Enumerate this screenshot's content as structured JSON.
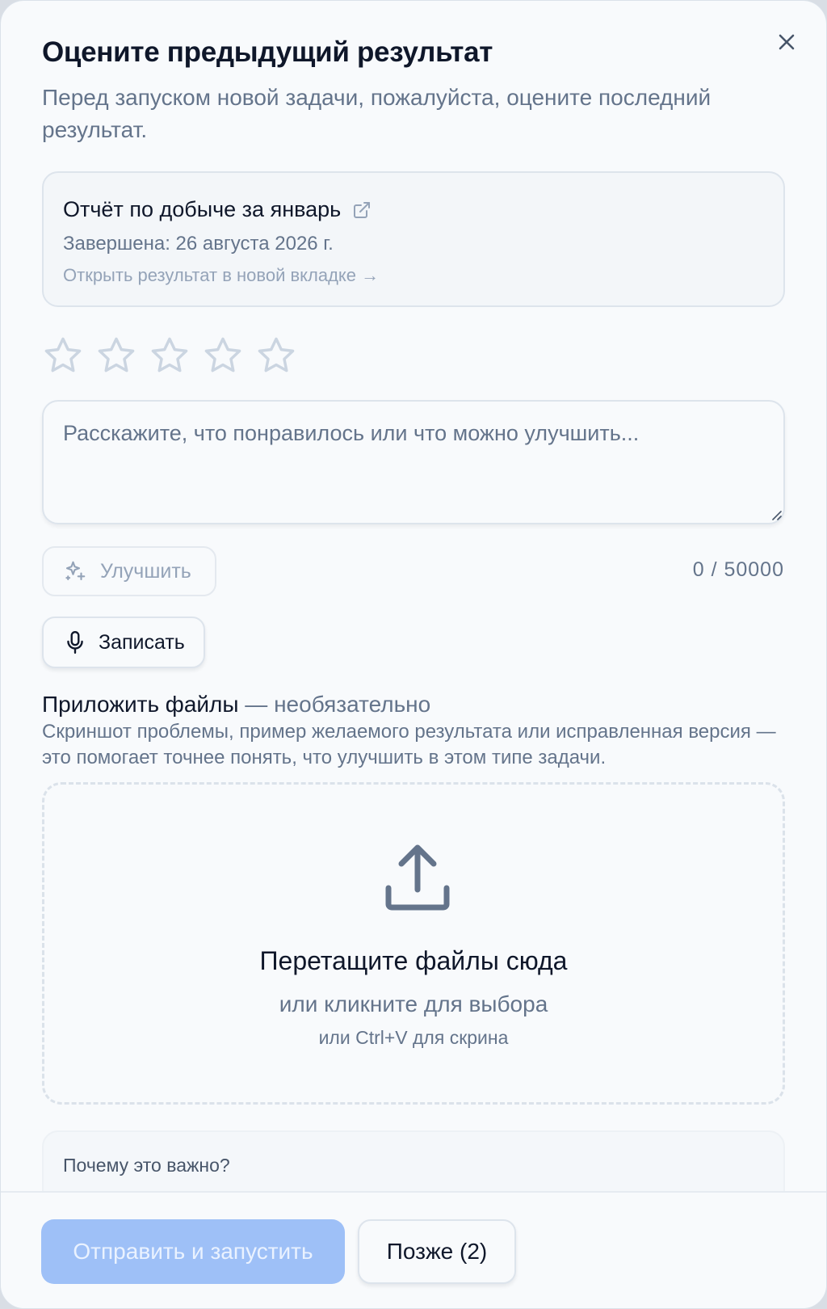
{
  "dialog": {
    "title": "Оцените предыдущий результат",
    "subtitle": "Перед запуском новой задачи, пожалуйста, оцените последний результат.",
    "close_icon": "close-icon"
  },
  "result": {
    "title": "Отчёт по добыче за январь",
    "date": "Завершена: 26 августа 2026 г.",
    "open_link": "Открыть результат в новой вкладке →",
    "icon": "external-link-icon"
  },
  "rating": {
    "value": 0,
    "max": 5,
    "star_color": "#cbd5e1"
  },
  "feedback": {
    "placeholder": "Расскажите, что понравилось или что можно улучшить...",
    "value": "",
    "counter": "0 / 50000"
  },
  "improve_button": {
    "label": "Улучшить",
    "icon": "sparkles-icon"
  },
  "record_button": {
    "label": "Записать",
    "icon": "microphone-icon"
  },
  "attach": {
    "title": "Приложить файлы",
    "optional": " — необязательно",
    "description": "Скриншот проблемы, пример желаемого результата или исправленная версия — это помогает точнее понять, что улучшить в этом типе задачи."
  },
  "dropzone": {
    "icon": "upload-icon",
    "title": "Перетащите файлы сюда",
    "subtitle": "или кликните для выбора",
    "hint": "или Ctrl+V для скрина"
  },
  "why": {
    "title": "Почему это важно?"
  },
  "footer": {
    "submit_label": "Отправить и запустить",
    "later_label": "Позже (2)"
  },
  "colors": {
    "primary_disabled": "#9ec0f7",
    "text_muted": "#64748b",
    "border": "#dde4ec"
  }
}
